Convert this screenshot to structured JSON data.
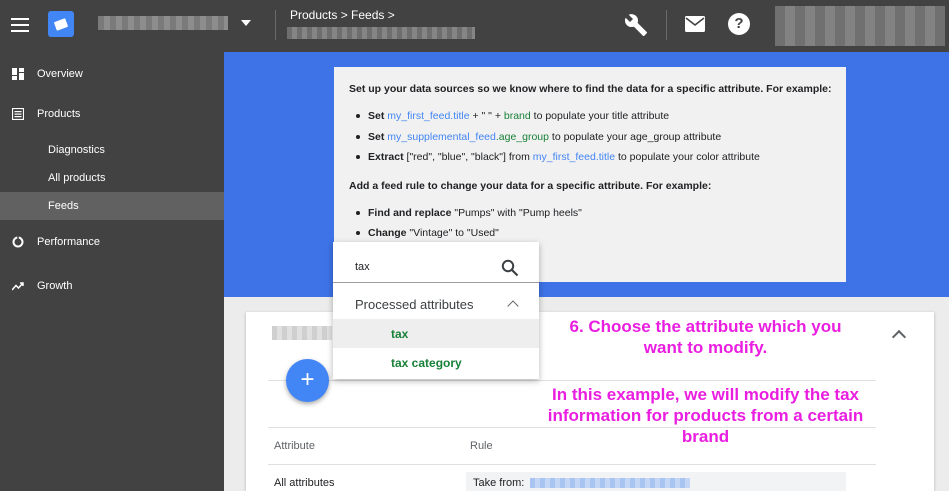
{
  "header": {
    "breadcrumb": "Products > Feeds >"
  },
  "sidebar": {
    "items": [
      {
        "label": "Overview",
        "icon": "dashboard-icon"
      },
      {
        "label": "Products",
        "icon": "list-icon"
      },
      {
        "label": "Diagnostics"
      },
      {
        "label": "All products"
      },
      {
        "label": "Feeds"
      },
      {
        "label": "Performance",
        "icon": "pie-chart-icon"
      },
      {
        "label": "Growth",
        "icon": "trending-up-icon"
      }
    ]
  },
  "info": {
    "intro_sources": "Set up your data sources so we know where to find the data for a specific attribute. For example:",
    "line1": {
      "verb": "Set",
      "feed": "my_first_feed",
      "attr": ".title",
      "plus1": " + \" \" + ",
      "brand": "brand",
      "rest": " to populate your title attribute"
    },
    "line2": {
      "verb": "Set",
      "feed": "my_supplemental_feed",
      "attr": ".age_group",
      "rest": " to populate your age_group attribute"
    },
    "line3": {
      "verb": "Extract",
      "values": " [\"red\", \"blue\", \"black\"] from ",
      "feed": "my_first_feed",
      "attr": ".title",
      "rest": " to populate your color attribute"
    },
    "intro_rules": "Add a feed rule to change your data for a specific attribute. For example:",
    "line4": {
      "verb": "Find and replace",
      "rest": " \"Pumps\" with \"Pump heels\""
    },
    "line5": {
      "verb": "Change",
      "rest": " \"Vintage\" to \"Used\""
    }
  },
  "dropdown": {
    "search_value": "tax",
    "group_label": "Processed attributes",
    "options": [
      "tax",
      "tax category"
    ]
  },
  "table": {
    "col_attribute": "Attribute",
    "col_rule": "Rule",
    "row_attribute": "All attributes",
    "row_rule_prefix": "Take from:"
  },
  "fab": {
    "label": "+"
  },
  "annotations": {
    "step": "6. Choose the attribute which you want to modify.",
    "example": "In this example, we will modify the tax information for products from a certain brand"
  },
  "colors": {
    "topbar": "#424242",
    "band": "#3d73e6",
    "accent_blue": "#4285f4",
    "attr_green": "#188038",
    "annotation": "#e91ee0"
  }
}
